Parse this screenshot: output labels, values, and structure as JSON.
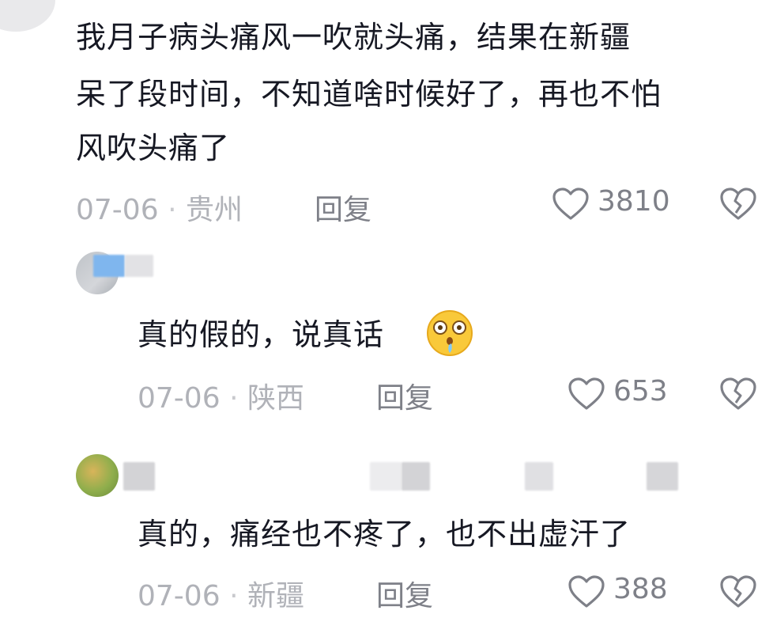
{
  "comments": [
    {
      "text_lines": [
        "我月子病头痛风一吹就头痛，结果在新疆",
        "呆了段时间，不知道啥时候好了，再也不怕",
        "风吹头痛了"
      ],
      "date": "07-06",
      "location": "贵州",
      "reply_label": "回复",
      "likes": "3810"
    },
    {
      "text_lines": [
        "真的假的，说真话"
      ],
      "emoji": "drooling-shocked-face-emoji",
      "date": "07-06",
      "location": "陕西",
      "reply_label": "回复",
      "likes": "653"
    },
    {
      "text_lines": [
        "真的，痛经也不疼了，也不出虚汗了"
      ],
      "date": "07-06",
      "location": "新疆",
      "reply_label": "回复",
      "likes": "388"
    }
  ],
  "icons": {
    "like": "heart-icon",
    "dislike": "broken-heart-icon"
  },
  "colors": {
    "text": "#161823",
    "meta": "#b0b2b8",
    "secondary": "#7e8088"
  }
}
